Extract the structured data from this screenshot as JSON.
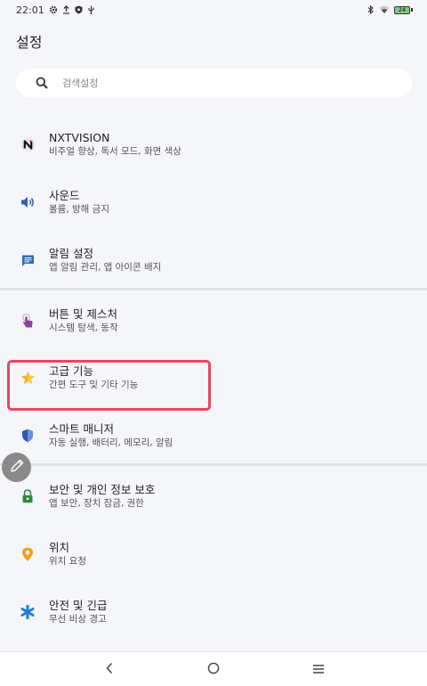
{
  "status_bar": {
    "time": "22:01",
    "battery": "24",
    "left_icons": [
      "settings-icon",
      "upload-icon",
      "shield-icon",
      "usb-icon"
    ],
    "right_icons": [
      "bluetooth-icon",
      "wifi-icon",
      "battery-icon"
    ]
  },
  "page": {
    "title": "설정"
  },
  "search": {
    "placeholder": "검색설정",
    "icon": "search-icon"
  },
  "items": [
    {
      "title": "NXTVISION",
      "subtitle": "비주얼 향상, 독서 모드, 화면 색상",
      "icon": "nxtvision-icon",
      "color": "#1a1a1a"
    },
    {
      "title": "사운드",
      "subtitle": "볼륨, 방해 금지",
      "icon": "speaker-icon",
      "color": "#2f5db8"
    },
    {
      "title": "알림 설정",
      "subtitle": "앱 알림 관리, 앱 아이콘 배지",
      "icon": "notification-icon",
      "color": "#2f6fb3"
    },
    {
      "title": "버튼 및 제스처",
      "subtitle": "시스템 탐색, 동작",
      "icon": "gesture-icon",
      "color": "#8e3fa0"
    },
    {
      "title": "고급 기능",
      "subtitle": "간편 도구 및 기타 기능",
      "icon": "star-icon",
      "color": "#f2b21f"
    },
    {
      "title": "스마트 매니저",
      "subtitle": "자동 실행, 배터리, 메모리, 알림",
      "icon": "shield-icon",
      "color": "#2d56b5"
    },
    {
      "title": "보안 및 개인 정보 보호",
      "subtitle": "앱 보안, 장치 잠금, 권한",
      "icon": "lock-icon",
      "color": "#2f8a3c"
    },
    {
      "title": "위치",
      "subtitle": "위치 요청",
      "icon": "location-icon",
      "color": "#f2a01f"
    },
    {
      "title": "안전 및 긴급",
      "subtitle": "무선 비상 경고",
      "icon": "asterisk-icon",
      "color": "#1f7fd0"
    }
  ],
  "nav": {
    "back": "back-icon",
    "home": "home-icon",
    "menu": "menu-icon"
  },
  "colors": {
    "background": "#f5f6f9",
    "highlight": "#e8475f",
    "divider": "#e2e3e7"
  }
}
